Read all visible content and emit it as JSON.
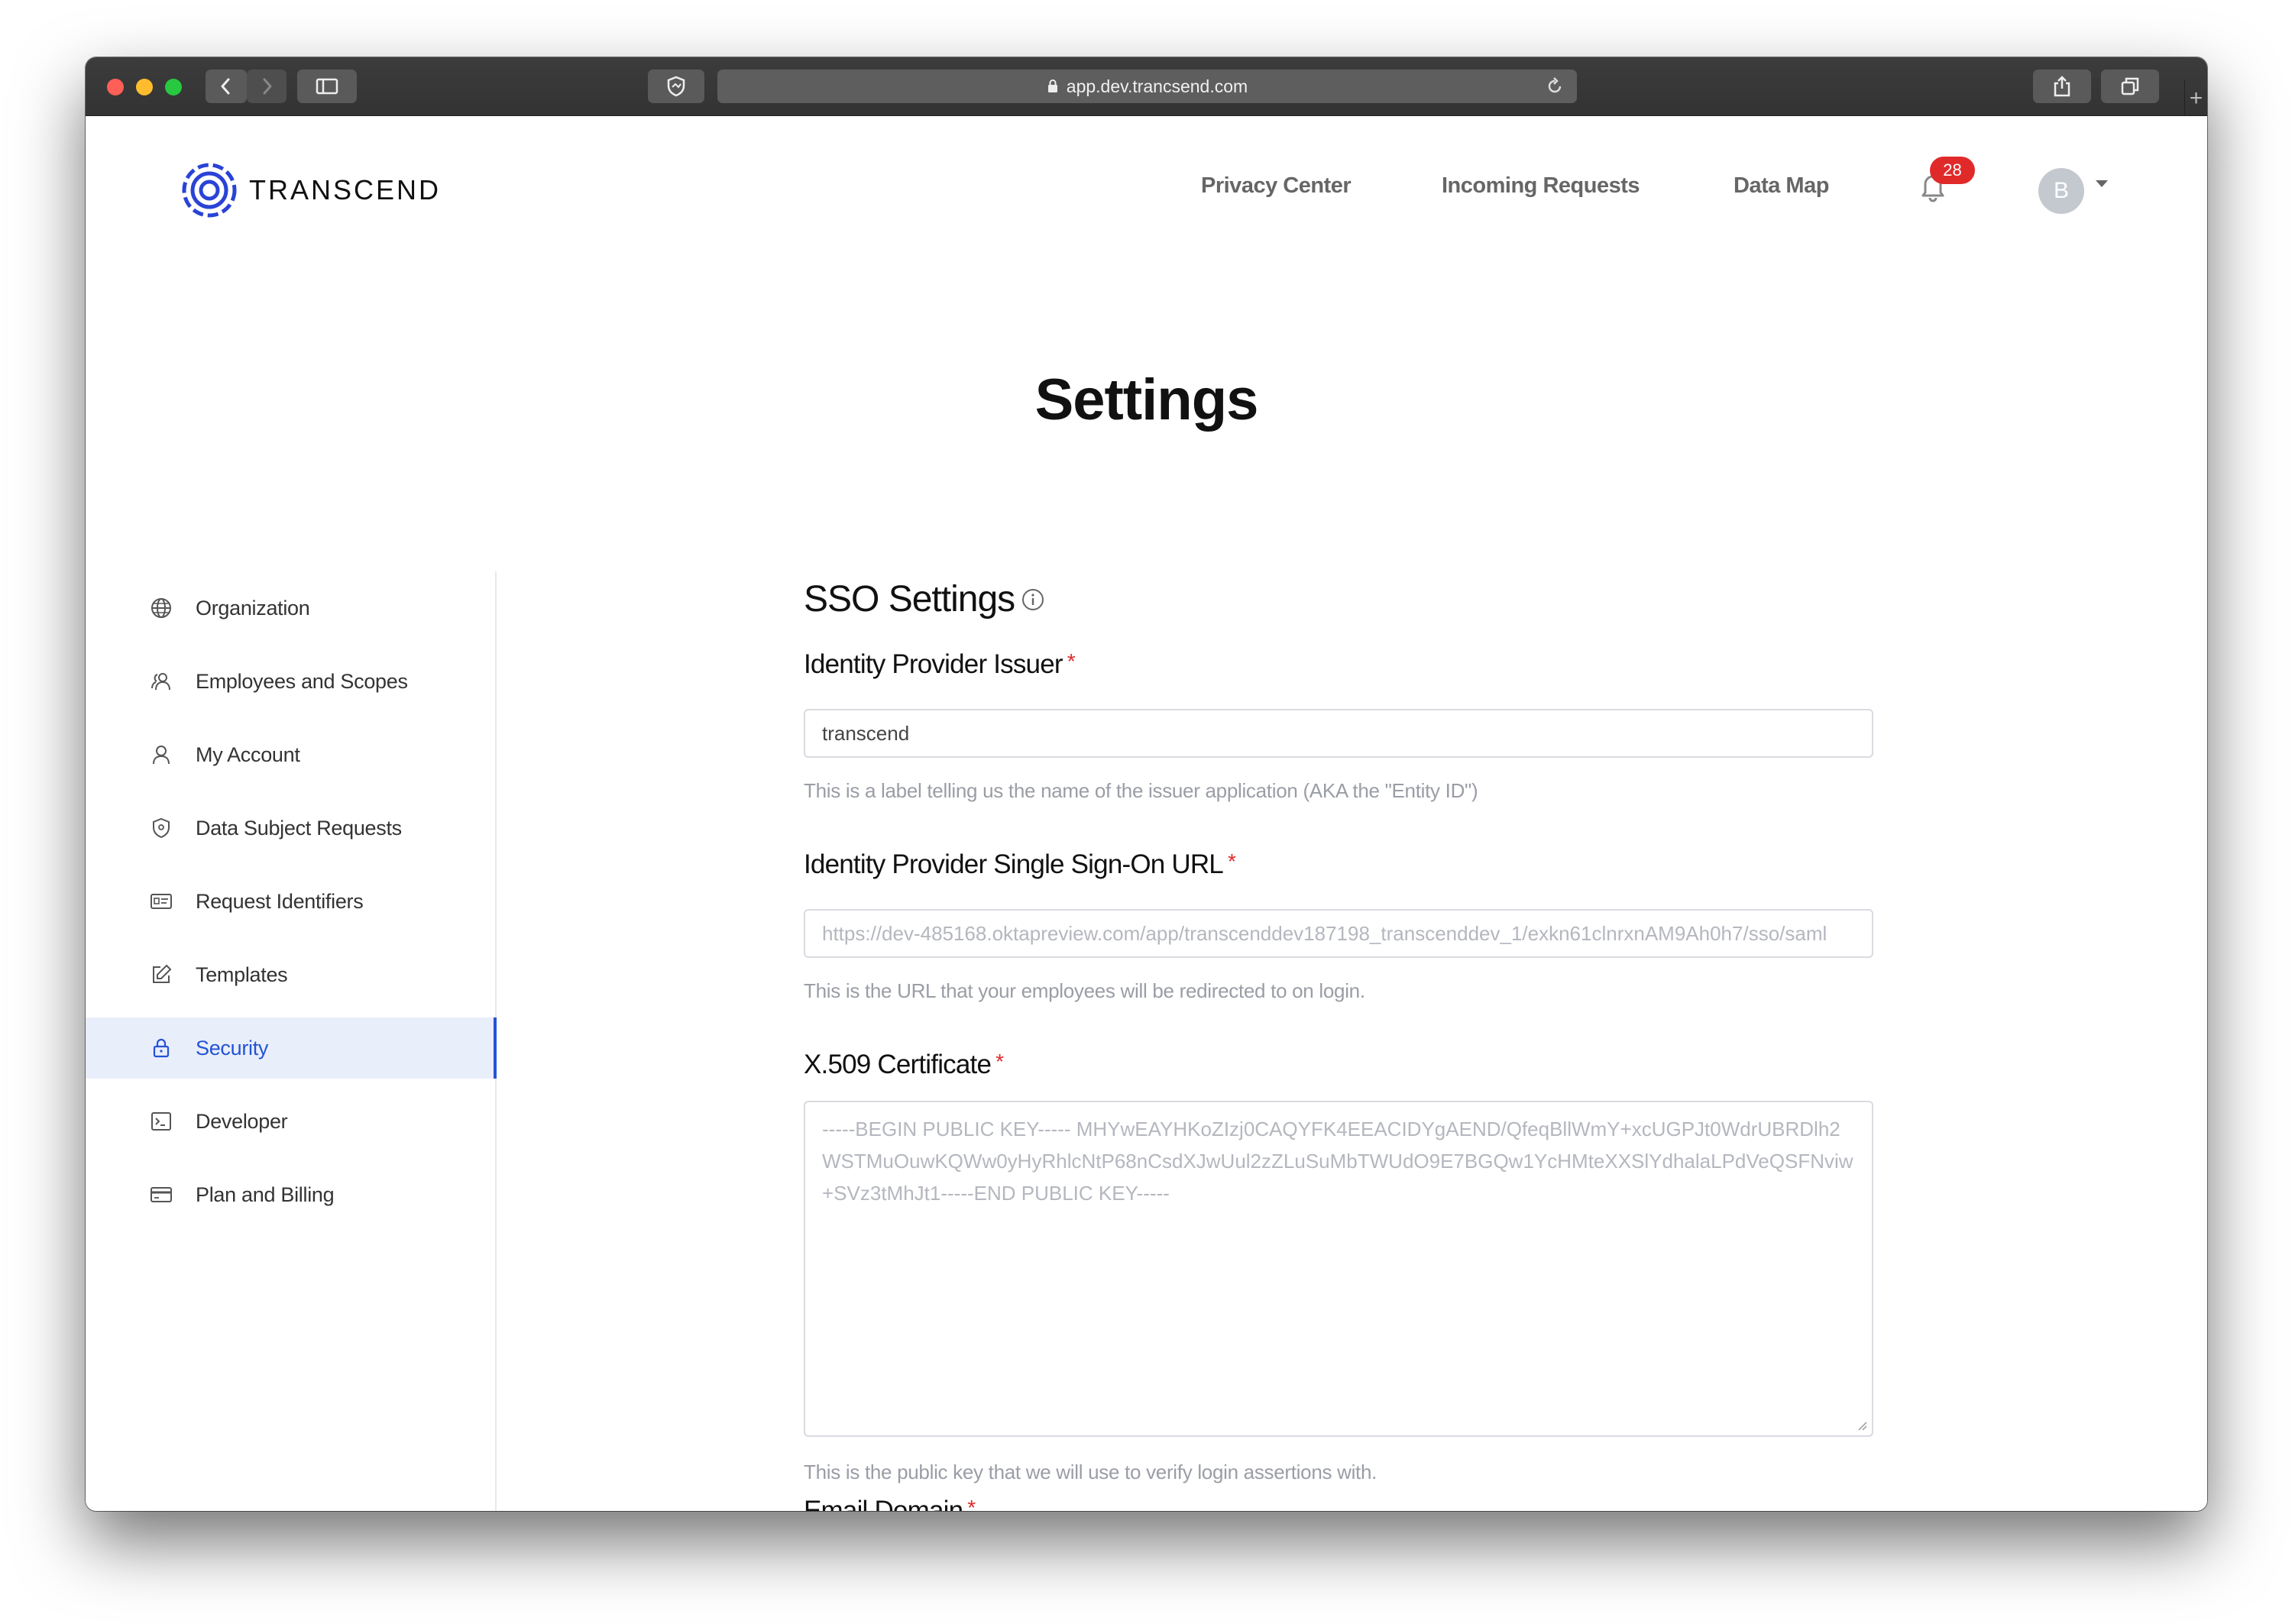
{
  "browser": {
    "url": "app.dev.trancsend.com"
  },
  "header": {
    "brand": "TRANSCEND",
    "nav": [
      "Privacy Center",
      "Incoming Requests",
      "Data Map"
    ],
    "notification_count": "28",
    "avatar_initial": "B"
  },
  "page": {
    "title": "Settings"
  },
  "sidebar": {
    "items": [
      {
        "label": "Organization",
        "icon": "globe-icon",
        "active": false
      },
      {
        "label": "Employees and Scopes",
        "icon": "users-icon",
        "active": false
      },
      {
        "label": "My Account",
        "icon": "user-icon",
        "active": false
      },
      {
        "label": "Data Subject Requests",
        "icon": "shield-icon",
        "active": false
      },
      {
        "label": "Request Identifiers",
        "icon": "id-card-icon",
        "active": false
      },
      {
        "label": "Templates",
        "icon": "edit-icon",
        "active": false
      },
      {
        "label": "Security",
        "icon": "lock-icon",
        "active": true
      },
      {
        "label": "Developer",
        "icon": "terminal-icon",
        "active": false
      },
      {
        "label": "Plan and Billing",
        "icon": "credit-card-icon",
        "active": false
      }
    ]
  },
  "form": {
    "section_title": "SSO Settings",
    "issuer": {
      "label": "Identity Provider Issuer",
      "value": "transcend",
      "help": "This is a label telling us the name of the issuer application (AKA the \"Entity ID\")"
    },
    "sso_url": {
      "label": "Identity Provider Single Sign-On URL",
      "placeholder": "https://dev-485168.oktapreview.com/app/transcenddev187198_transcenddev_1/exkn61clnrxnAM9Ah0h7/sso/saml",
      "help": "This is the URL that your employees will be redirected to on login."
    },
    "certificate": {
      "label": "X.509 Certificate",
      "placeholder": "-----BEGIN PUBLIC KEY----- MHYwEAYHKoZIzj0CAQYFK4EEACIDYgAEND/QfeqBllWmY+xcUGPJt0WdrUBRDlh2WSTMuOuwKQWw0yHyRhlcNtP68nCsdXJwUul2zZLuSuMbTWUdO9E7BGQw1YcHMteXXSlYdhalaLPdVeQSFNviw+SVz3tMhJt1-----END PUBLIC KEY-----",
      "help": "This is the public key that we will use to verify login assertions with."
    },
    "email_domain": {
      "label": "Email Domain"
    }
  },
  "colors": {
    "accent": "#2353d6",
    "required": "#e02a2a",
    "active_bg": "#e9eefb"
  }
}
